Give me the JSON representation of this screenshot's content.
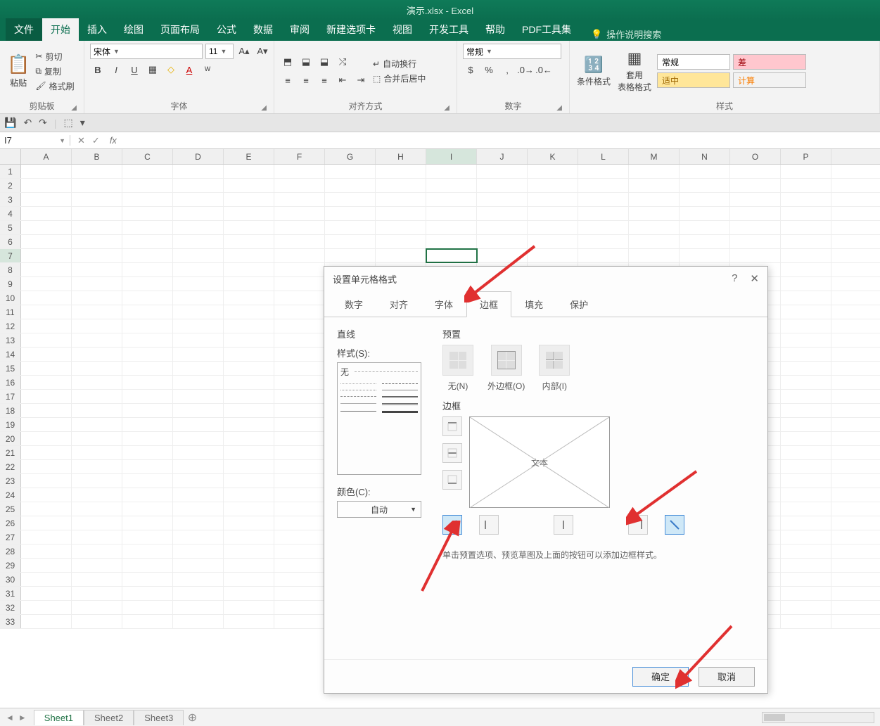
{
  "app": {
    "title": "演示.xlsx - Excel"
  },
  "tabs": {
    "file": "文件",
    "home": "开始",
    "insert": "插入",
    "draw": "绘图",
    "layout": "页面布局",
    "formulas": "公式",
    "data": "数据",
    "review": "审阅",
    "newtab": "新建选项卡",
    "view": "视图",
    "developer": "开发工具",
    "help": "帮助",
    "pdf": "PDF工具集",
    "tellme": "操作说明搜索"
  },
  "ribbon": {
    "clipboard": {
      "label": "剪贴板",
      "paste": "粘贴",
      "cut": "剪切",
      "copy": "复制",
      "painter": "格式刷"
    },
    "font": {
      "label": "字体",
      "name": "宋体",
      "size": "11"
    },
    "align": {
      "label": "对齐方式",
      "wrap": "自动换行",
      "merge": "合并后居中"
    },
    "number": {
      "label": "数字",
      "format": "常规"
    },
    "styles": {
      "label": "样式",
      "conditional": "条件格式",
      "table": "套用\n表格格式",
      "normal": "常规",
      "good": "适中",
      "bad": "差",
      "calc": "计算"
    }
  },
  "namebox": "I7",
  "columns": [
    "A",
    "B",
    "C",
    "D",
    "E",
    "F",
    "G",
    "H",
    "I",
    "J",
    "K",
    "L",
    "M",
    "N",
    "O",
    "P"
  ],
  "active": {
    "col": "I",
    "row": 7
  },
  "sheets": {
    "s1": "Sheet1",
    "s2": "Sheet2",
    "s3": "Sheet3"
  },
  "dialog": {
    "title": "设置单元格格式",
    "help": "?",
    "tabs": {
      "number": "数字",
      "align": "对齐",
      "font": "字体",
      "border": "边框",
      "fill": "填充",
      "protect": "保护"
    },
    "line_section": "直线",
    "style_label": "样式(S):",
    "style_none": "无",
    "color_label": "颜色(C):",
    "color_auto": "自动",
    "preset_section": "预置",
    "preset_none": "无(N)",
    "preset_outline": "外边框(O)",
    "preset_inside": "内部(I)",
    "border_section": "边框",
    "preview_text": "文本",
    "hint": "单击预置选项、预览草图及上面的按钮可以添加边框样式。",
    "ok": "确定",
    "cancel": "取消"
  }
}
